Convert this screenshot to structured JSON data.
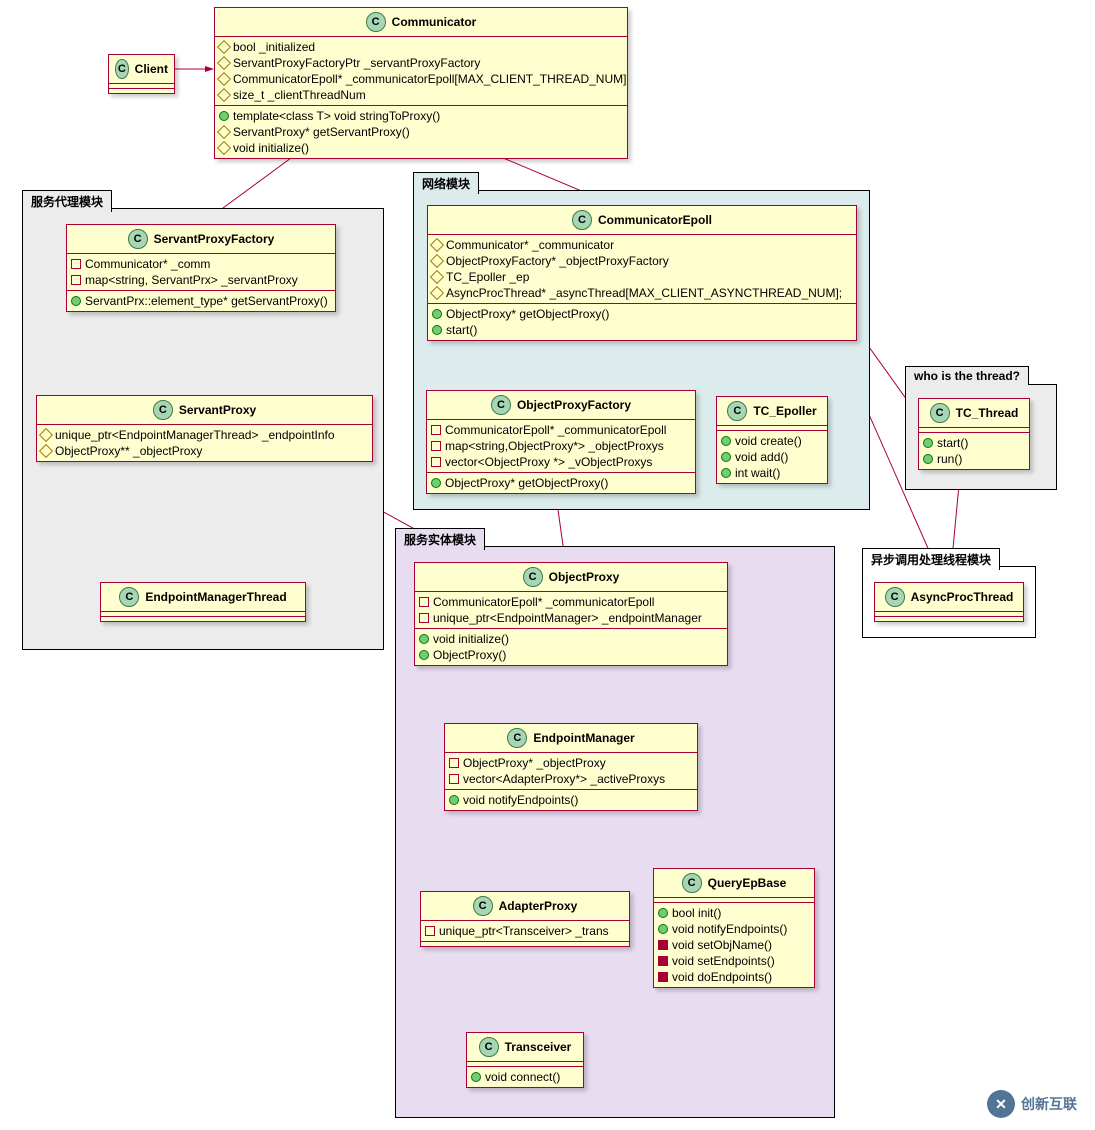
{
  "packages": {
    "proxy": {
      "label": "服务代理模块"
    },
    "network": {
      "label": "网络模块"
    },
    "entity": {
      "label": "服务实体模块"
    },
    "thread": {
      "label": "who is the thread?"
    },
    "async": {
      "label": "异步调用处理线程模块"
    }
  },
  "classes": {
    "client": {
      "title": "Client"
    },
    "communicator": {
      "title": "Communicator",
      "fields": [
        "bool _initialized",
        "ServantProxyFactoryPtr _servantProxyFactory",
        "CommunicatorEpoll* _communicatorEpoll[MAX_CLIENT_THREAD_NUM]",
        "size_t _clientThreadNum"
      ],
      "methods": [
        "template<class T> void stringToProxy()",
        "ServantProxy* getServantProxy()",
        "void initialize()"
      ]
    },
    "servantProxyFactory": {
      "title": "ServantProxyFactory",
      "fields": [
        "Communicator* _comm",
        "map<string, ServantPrx> _servantProxy"
      ],
      "methods": [
        "ServantPrx::element_type* getServantProxy()"
      ]
    },
    "servantProxy": {
      "title": "ServantProxy",
      "fields": [
        "unique_ptr<EndpointManagerThread> _endpointInfo",
        "ObjectProxy** _objectProxy"
      ]
    },
    "endpointManagerThread": {
      "title": "EndpointManagerThread"
    },
    "communicatorEpoll": {
      "title": "CommunicatorEpoll",
      "fields": [
        "Communicator* _communicator",
        "ObjectProxyFactory* _objectProxyFactory",
        "TC_Epoller _ep",
        "AsyncProcThread* _asyncThread[MAX_CLIENT_ASYNCTHREAD_NUM];"
      ],
      "methods": [
        "ObjectProxy* getObjectProxy()",
        "start()"
      ]
    },
    "objectProxyFactory": {
      "title": "ObjectProxyFactory",
      "fields": [
        "CommunicatorEpoll* _communicatorEpoll",
        "map<string,ObjectProxy*> _objectProxys",
        "vector<ObjectProxy *> _vObjectProxys"
      ],
      "methods": [
        "ObjectProxy* getObjectProxy()"
      ]
    },
    "tcEpoller": {
      "title": "TC_Epoller",
      "methods": [
        "void create()",
        "void add()",
        "int wait()"
      ]
    },
    "tcThread": {
      "title": "TC_Thread",
      "methods": [
        "start()",
        "run()"
      ]
    },
    "asyncProcThread": {
      "title": "AsyncProcThread"
    },
    "objectProxy": {
      "title": "ObjectProxy",
      "fields": [
        "CommunicatorEpoll* _communicatorEpoll",
        "unique_ptr<EndpointManager> _endpointManager"
      ],
      "methods": [
        "void initialize()",
        "ObjectProxy()"
      ]
    },
    "endpointManager": {
      "title": "EndpointManager",
      "fields": [
        "ObjectProxy* _objectProxy",
        "vector<AdapterProxy*> _activeProxys"
      ],
      "methods": [
        "void notifyEndpoints()"
      ]
    },
    "adapterProxy": {
      "title": "AdapterProxy",
      "fields": [
        "unique_ptr<Transceiver> _trans"
      ]
    },
    "queryEpBase": {
      "title": "QueryEpBase",
      "methods": [
        {
          "t": "bool init()",
          "v": "circle"
        },
        {
          "t": "void notifyEndpoints()",
          "v": "circle"
        },
        {
          "t": "void setObjName()",
          "v": "square-filled"
        },
        {
          "t": "void setEndpoints()",
          "v": "square-filled"
        },
        {
          "t": "void doEndpoints()",
          "v": "square-filled"
        }
      ]
    },
    "transceiver": {
      "title": "Transceiver",
      "methods": [
        "void connect()"
      ]
    }
  },
  "watermark": "创新互联"
}
